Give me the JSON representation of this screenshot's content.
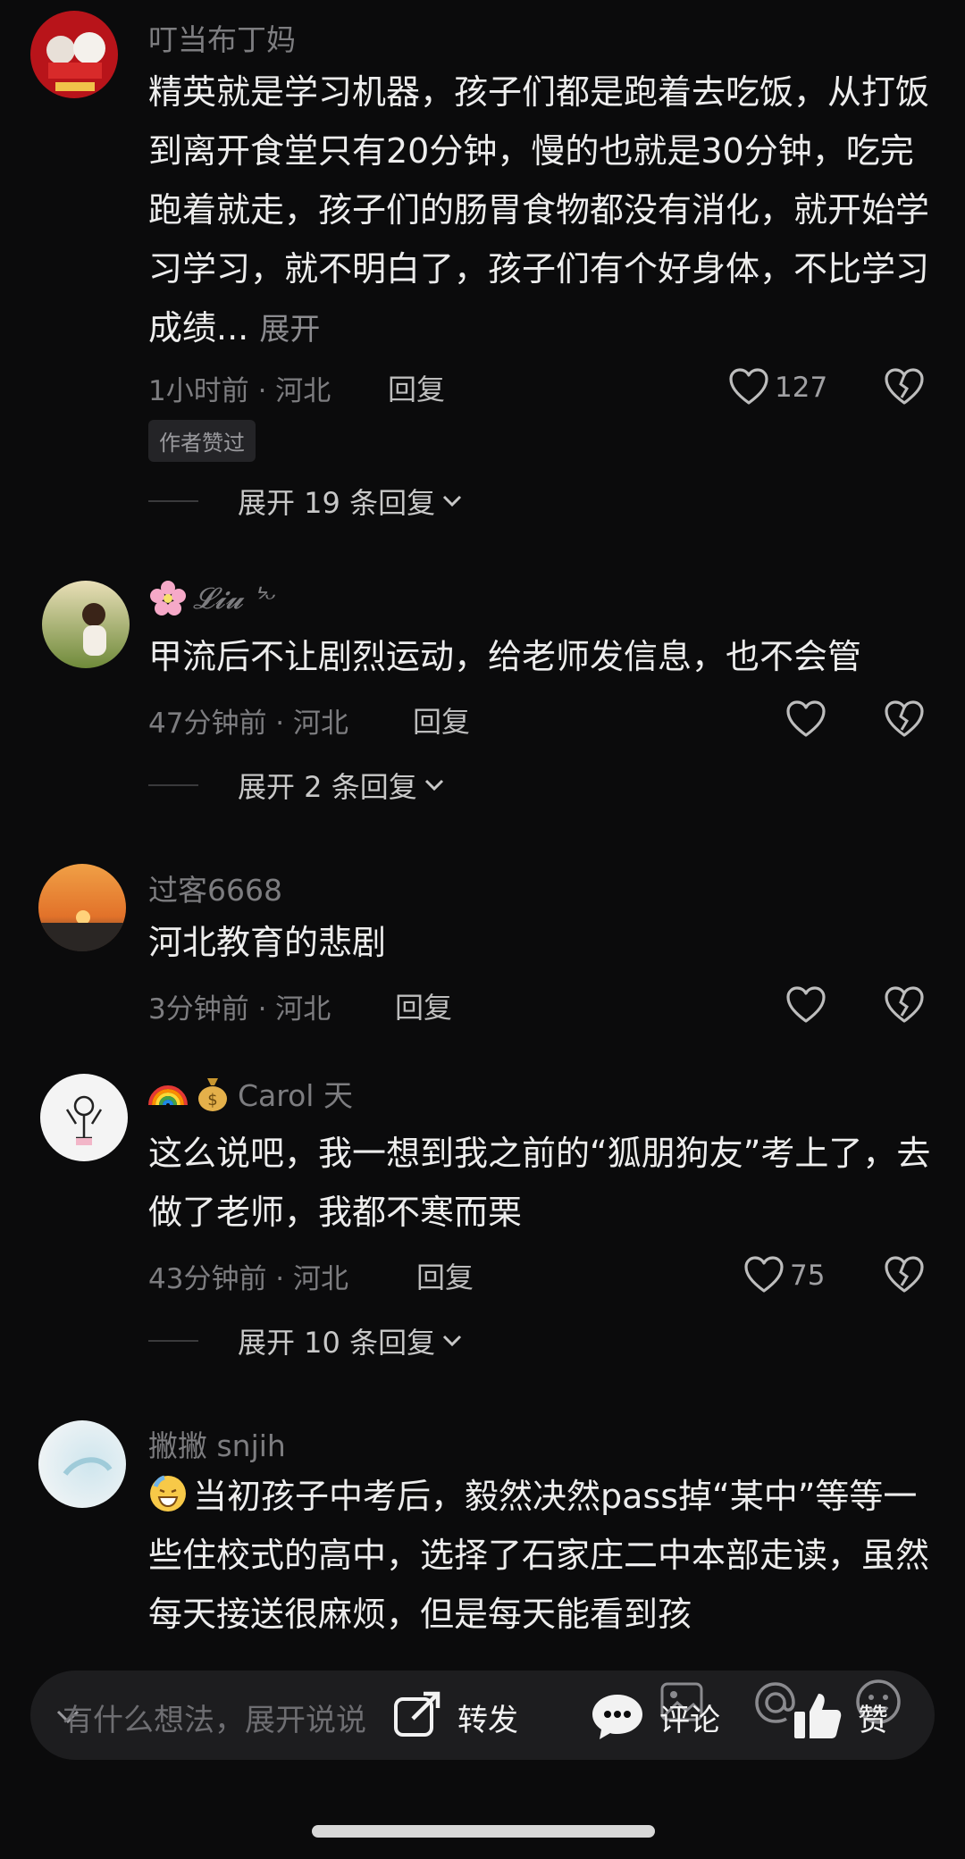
{
  "comments": [
    {
      "username": "叮当布丁妈",
      "text": "精英就是学习机器，孩子们都是跑着去吃饭，从打饭到离开食堂只有20分钟，慢的也就是30分钟，吃完跑着就走，孩子们的肠胃食物都没有消化，就开始学习学习，就不明白了，孩子们有个好身体，不比学习成绩...",
      "more": "展开",
      "time": "1小时前 · 河北",
      "reply": "回复",
      "likes": "127",
      "badge": "作者赞过",
      "expand": "展开 19 条回复"
    },
    {
      "username": "𝓛𝓲𝓾 ᔾᵕ",
      "text": "甲流后不让剧烈运动，给老师发信息，也不会管",
      "time": "47分钟前 · 河北",
      "reply": "回复",
      "expand": "展开 2 条回复"
    },
    {
      "username": "过客6668",
      "text": "河北教育的悲剧",
      "time": "3分钟前 · 河北",
      "reply": "回复"
    },
    {
      "username": "Carol 天",
      "text": "这么说吧，我一想到我之前的“狐朋狗友”考上了，去做了老师，我都不寒而栗",
      "time": "43分钟前 · 河北",
      "reply": "回复",
      "likes": "75",
      "expand": "展开 10 条回复"
    },
    {
      "username": "撇撇 snjih",
      "text": "当初孩子中考后，毅然决然pass掉“某中”等等一些住校式的高中，选择了石家庄二中本部走读，虽然每天接送很麻烦，但是每天能看到孩"
    }
  ],
  "bottom_bar": {
    "placeholder": "有什么想法，展开说说",
    "share": "转发",
    "comment": "评论",
    "like": "赞"
  },
  "icons": {
    "like": "heart-outline-icon",
    "dislike": "broken-heart-icon",
    "expand": "chevron-down-icon",
    "emoji_flower": "cherry-blossom-icon",
    "emoji_rainbow": "rainbow-icon",
    "emoji_money": "money-bag-icon",
    "emoji_grin": "grinning-sweat-icon"
  },
  "colors": {
    "background": "#0b0b0c",
    "text_primary": "#ededed",
    "text_secondary": "#7d7d80",
    "badge_bg": "#242427"
  }
}
